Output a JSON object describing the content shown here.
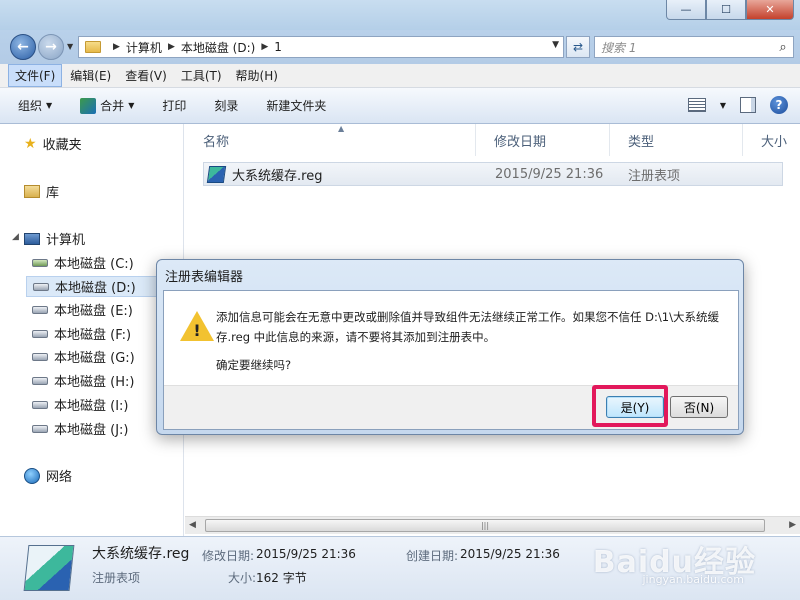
{
  "window": {
    "minimize": "—",
    "maximize": "☐",
    "close": "✕"
  },
  "address_bar": {
    "crumbs": [
      "计算机",
      "本地磁盘 (D:)",
      "1"
    ],
    "search_placeholder": "搜索 1"
  },
  "menu": [
    "文件(F)",
    "编辑(E)",
    "查看(V)",
    "工具(T)",
    "帮助(H)"
  ],
  "toolbar": {
    "organize": "组织",
    "merge": "合并",
    "print": "打印",
    "burn": "刻录",
    "new_folder": "新建文件夹",
    "help": "?"
  },
  "nav": {
    "favorites": "收藏夹",
    "libraries": "库",
    "computer": "计算机",
    "drives": [
      "本地磁盘 (C:)",
      "本地磁盘 (D:)",
      "本地磁盘 (E:)",
      "本地磁盘 (F:)",
      "本地磁盘 (G:)",
      "本地磁盘 (H:)",
      "本地磁盘 (I:)",
      "本地磁盘 (J:)"
    ],
    "network": "网络"
  },
  "columns": [
    "名称",
    "修改日期",
    "类型",
    "大小"
  ],
  "files": [
    {
      "name": "大系统缓存.reg",
      "modified": "2015/9/25 21:36",
      "type": "注册表项"
    }
  ],
  "details": {
    "name": "大系统缓存.reg",
    "modified_label": "修改日期:",
    "modified": "2015/9/25 21:36",
    "created_label": "创建日期:",
    "created": "2015/9/25 21:36",
    "type": "注册表项",
    "size_label": "大小:",
    "size": "162 字节"
  },
  "dialog": {
    "title": "注册表编辑器",
    "message": "添加信息可能会在无意中更改或删除值并导致组件无法继续正常工作。如果您不信任 D:\\1\\大系统缓存.reg 中此信息的来源，请不要将其添加到注册表中。",
    "question": "确定要继续吗?",
    "yes": "是(Y)",
    "no": "否(N)"
  },
  "watermark": {
    "brand": "Baidu经验",
    "url": "jingyan.baidu.com"
  }
}
